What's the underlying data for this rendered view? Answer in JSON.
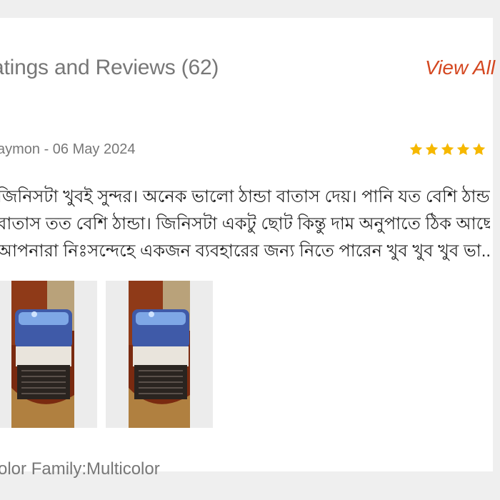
{
  "reviews_section": {
    "title": "atings and Reviews (62)",
    "view_all_label": "View All",
    "accent_color": "#d44720",
    "star_color": "#f6b800"
  },
  "review": {
    "author_date": "aymon - 06 May 2024",
    "rating": 5,
    "text_lines": [
      "জিনিসটা খুবই সুন্দর। অনেক ভালো ঠান্ডা বাতাস দেয়। পানি যত বেশি ঠান্ডা",
      "বাতাস তত বেশি ঠান্ডা। জিনিসটা একটু ছোট কিন্তু দাম অনুপাতে ঠিক আছে।",
      "আপনারা নিঃসন্দেহে একজন ব্যবহারের জন্য নিতে পারেন খুব খুব খুব ভা..."
    ],
    "photos": [
      {
        "icon": "review-photo-air-cooler"
      },
      {
        "icon": "review-photo-air-cooler"
      }
    ],
    "color_family": "olor Family:Multicolor"
  }
}
